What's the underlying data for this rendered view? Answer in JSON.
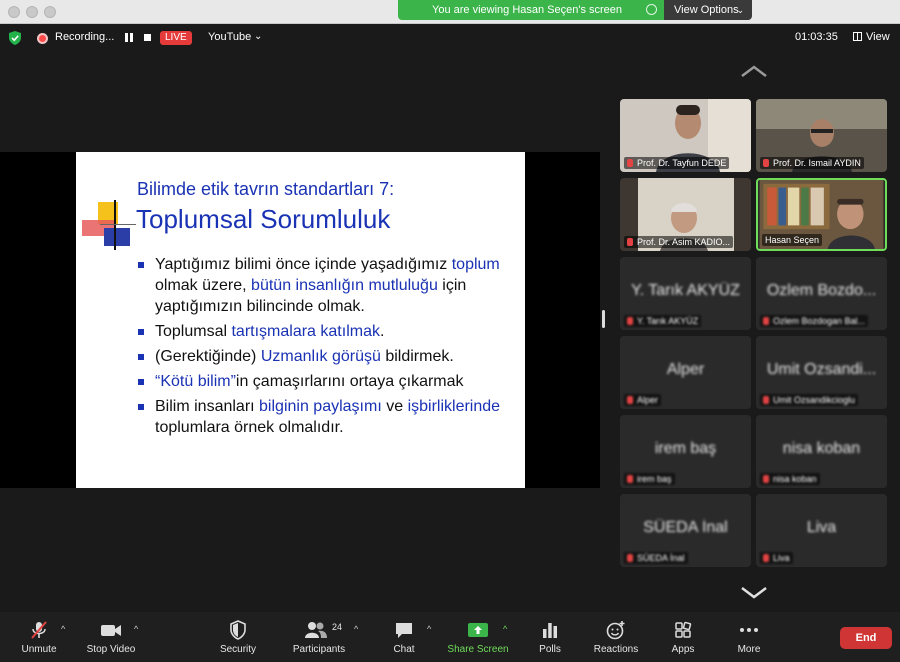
{
  "window": {
    "viewing_banner": "You are viewing Hasan Seçen's screen",
    "view_options": "View Options"
  },
  "topbar": {
    "recording": "Recording...",
    "live": "LIVE",
    "stream_target": "YouTube",
    "elapsed": "01:03:35",
    "view_label": "View"
  },
  "slide": {
    "subtitle": "Bilimde etik tavrın standartları 7:",
    "title": "Toplumsal Sorumluluk",
    "bullets": [
      {
        "pre": "Yaptığımız bilimi önce içinde yaşadığımız ",
        "hl1": "toplum",
        "mid": " olmak üzere, ",
        "hl2": "bütün insanlığın mutluluğu",
        "post": " için yaptığımızın bilincinde olmak."
      },
      {
        "pre": "Toplumsal ",
        "hl1": "tartışmalara katılmak",
        "post": "."
      },
      {
        "pre": "(Gerektiğinde) ",
        "hl1": "Uzmanlık görüşü",
        "post": " bildirmek."
      },
      {
        "hl1": "“Kötü bilim”",
        "post": "in çamaşırlarını ortaya çıkarmak"
      },
      {
        "pre": "Bilim insanları ",
        "hl1": "bilginin paylaşımı",
        "mid": " ve ",
        "hl2": "işbirliklerinde",
        "post": " toplumlara örnek olmalıdır."
      }
    ],
    "colors": {
      "highlight": "#1a32b4",
      "text": "#111111"
    }
  },
  "participants": [
    {
      "name": "Prof. Dr. Tayfun DEDE",
      "video": true,
      "muted": true
    },
    {
      "name": "Prof. Dr. Ismail AYDIN",
      "video": true,
      "muted": true
    },
    {
      "name": "Prof. Dr. Asim KADIO...",
      "video": true,
      "muted": true
    },
    {
      "name": "Hasan Seçen",
      "video": true,
      "muted": false,
      "active_speaker": true
    },
    {
      "name": "Y. Tarık AKYÜZ",
      "label": "Y. Tarık AKYÜZ",
      "video": false,
      "muted": true
    },
    {
      "name": "Ozlem Bozdo...",
      "label": "Ozlem Bozdogan Bal...",
      "video": false,
      "muted": true
    },
    {
      "name": "Alper",
      "label": "Alper",
      "video": false,
      "muted": true
    },
    {
      "name": "Umit Ozsandi...",
      "label": "Umit Ozsandikcioglu",
      "video": false,
      "muted": true
    },
    {
      "name": "irem baş",
      "label": "irem baş",
      "video": false,
      "muted": true
    },
    {
      "name": "nisa koban",
      "label": "nisa koban",
      "video": false,
      "muted": true
    },
    {
      "name": "SÜEDA İnal",
      "label": "SÜEDA İnal",
      "video": false,
      "muted": true
    },
    {
      "name": "Liva",
      "label": "Liva",
      "video": false,
      "muted": true
    }
  ],
  "toolbar": {
    "unmute": "Unmute",
    "stop_video": "Stop Video",
    "security": "Security",
    "participants": "Participants",
    "participant_count": "24",
    "chat": "Chat",
    "share_screen": "Share Screen",
    "polls": "Polls",
    "reactions": "Reactions",
    "apps": "Apps",
    "more": "More",
    "end": "End"
  },
  "colors": {
    "accent_green": "#6fdc5a",
    "live_red": "#e53b3b",
    "end_red": "#cf3535",
    "banner_green": "#3bb54a"
  }
}
